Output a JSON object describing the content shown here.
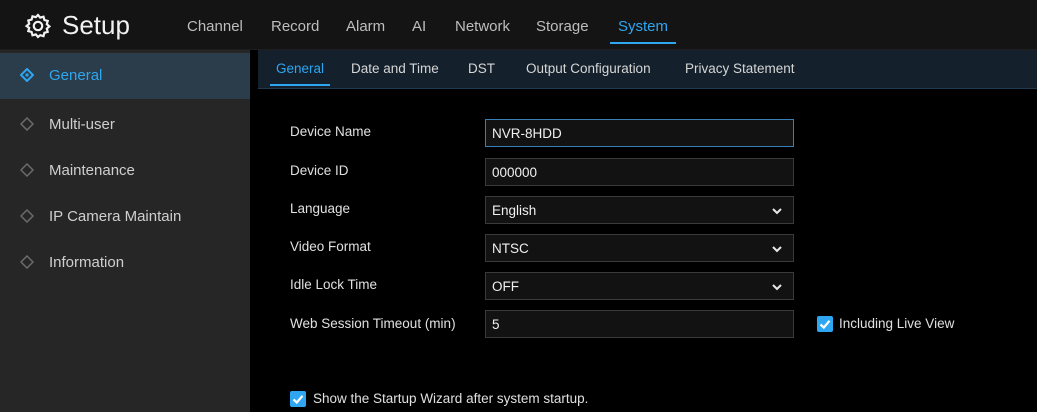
{
  "header": {
    "title": "Setup",
    "icon": "gear-icon",
    "nav": [
      {
        "label": "Channel"
      },
      {
        "label": "Record"
      },
      {
        "label": "Alarm"
      },
      {
        "label": "AI"
      },
      {
        "label": "Network"
      },
      {
        "label": "Storage"
      },
      {
        "label": "System",
        "active": true
      }
    ]
  },
  "sidebar": {
    "items": [
      {
        "label": "General",
        "active": true
      },
      {
        "label": "Multi-user"
      },
      {
        "label": "Maintenance"
      },
      {
        "label": "IP Camera Maintain"
      },
      {
        "label": "Information"
      }
    ]
  },
  "subtabs": [
    {
      "label": "General",
      "active": true
    },
    {
      "label": "Date and Time"
    },
    {
      "label": "DST"
    },
    {
      "label": "Output Configuration"
    },
    {
      "label": "Privacy Statement"
    }
  ],
  "form": {
    "device_name": {
      "label": "Device Name",
      "value": "NVR-8HDD"
    },
    "device_id": {
      "label": "Device ID",
      "value": "000000"
    },
    "language": {
      "label": "Language",
      "value": "English"
    },
    "video_format": {
      "label": "Video Format",
      "value": "NTSC"
    },
    "idle_lock_time": {
      "label": "Idle Lock Time",
      "value": "OFF"
    },
    "web_session_timeout": {
      "label": "Web Session Timeout (min)",
      "value": "5"
    },
    "including_live_view": {
      "label": "Including Live View",
      "checked": true
    },
    "startup_wizard": {
      "label": "Show the Startup Wizard after system startup.",
      "checked": true
    }
  },
  "colors": {
    "accent": "#2fa6f2",
    "sidebar_bg": "#262626",
    "active_bg": "#2b3d4a"
  }
}
